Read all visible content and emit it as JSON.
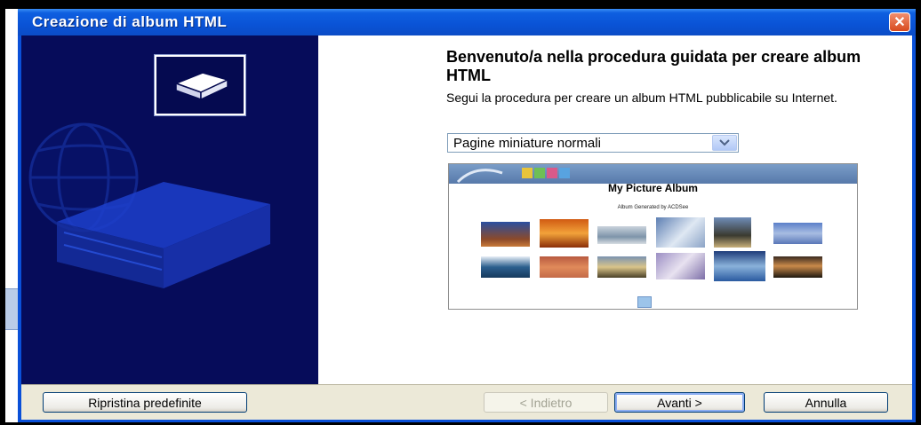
{
  "window": {
    "title": "Creazione di album HTML",
    "close_label": "✕"
  },
  "wizard": {
    "heading": "Benvenuto/a nella procedura guidata per creare album HTML",
    "description": "Segui la procedura per creare un album HTML pubblicabile su Internet.",
    "template_select": {
      "selected": "Pagine miniature normali"
    },
    "preview": {
      "album_title": "My Picture Album",
      "album_subtitle": "Album Generated by ACDSee"
    }
  },
  "buttons": {
    "reset": "Ripristina predefinite",
    "back": "< Indietro",
    "next": "Avanti >",
    "cancel": "Annulla"
  },
  "icons": {
    "logo": "book-icon",
    "watermark": "globe-book-icon",
    "dropdown": "chevron-down-icon",
    "close": "close-icon"
  },
  "colors": {
    "titlebar": "#0a53d6",
    "left_panel": "#060c5a",
    "button_bar": "#ece9d8",
    "close_button": "#d84a1e"
  }
}
